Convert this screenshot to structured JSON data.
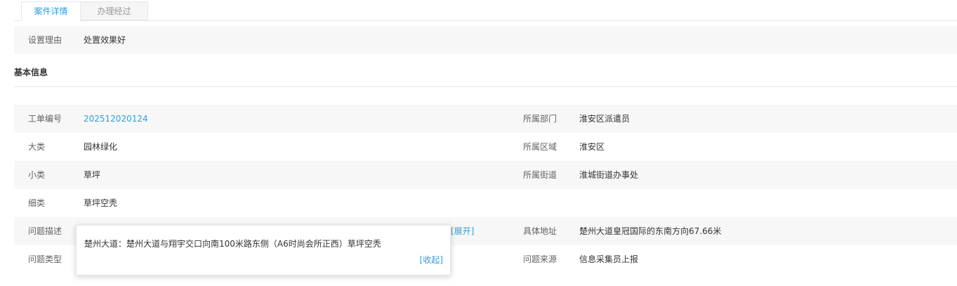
{
  "tabs": [
    {
      "label": "案件详情",
      "active": true
    },
    {
      "label": "办理经过",
      "active": false
    }
  ],
  "reason": {
    "label": "设置理由",
    "value": "处置效果好"
  },
  "section_title": "基本信息",
  "rows": {
    "order_no": {
      "label": "工单编号",
      "value": "202512020124"
    },
    "department": {
      "label": "所属部门",
      "value": "淮安区派遣员"
    },
    "category": {
      "label": "大类",
      "value": "园林绿化"
    },
    "region": {
      "label": "所属区域",
      "value": "淮安区"
    },
    "subcategory": {
      "label": "小类",
      "value": "草坪"
    },
    "street": {
      "label": "所属街道",
      "value": "淮城街道办事处"
    },
    "detail_category": {
      "label": "细类",
      "value": "草坪空秃"
    },
    "description": {
      "label": "问题描述",
      "expand_label": "[展开]"
    },
    "address": {
      "label": "具体地址",
      "value": "楚州大道皇冠国际的东南方向67.66米"
    },
    "problem_type": {
      "label": "问题类型"
    },
    "source": {
      "label": "问题来源",
      "value": "信息采集员上报"
    }
  },
  "popup": {
    "text": "楚州大道：楚州大道与翔宇交口向南100米路东侧（A6时尚会所正西）草坪空秃",
    "collapse_label": "[收起]"
  },
  "colors": {
    "accent": "#2e9fd8",
    "band": "#f7f7f7"
  }
}
